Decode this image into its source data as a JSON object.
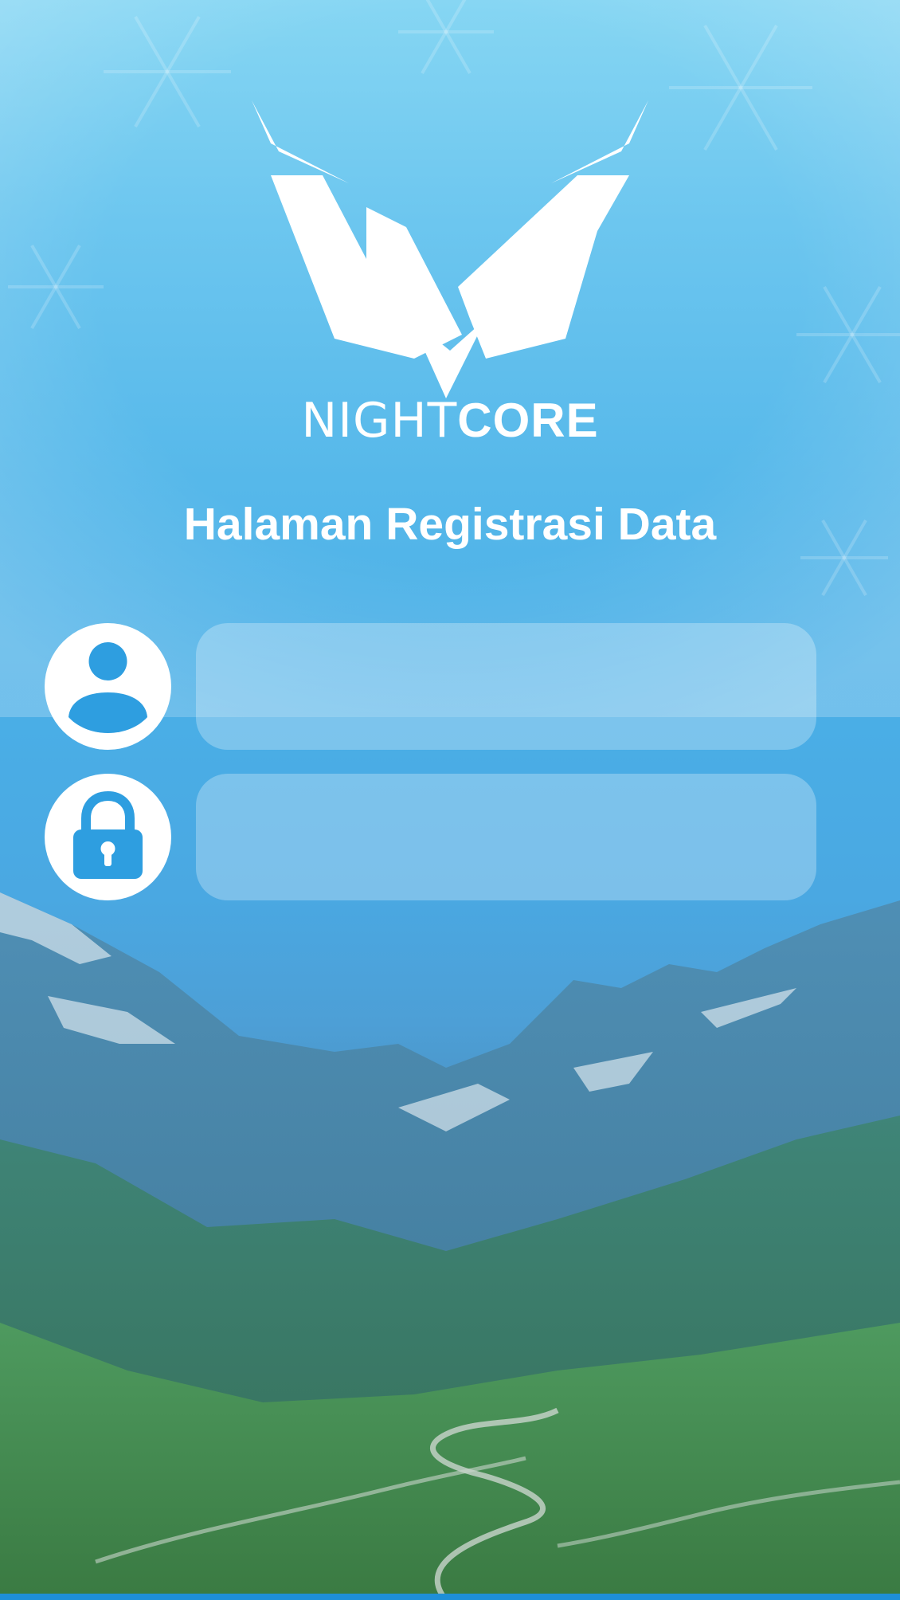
{
  "app": {
    "brand_light": "NIGHT",
    "brand_bold": "CORE"
  },
  "page": {
    "title": "Halaman Registrasi Data"
  },
  "form": {
    "username": {
      "value": "",
      "placeholder": "",
      "icon": "user-icon"
    },
    "password": {
      "value": "",
      "placeholder": "",
      "icon": "lock-icon"
    }
  },
  "colors": {
    "sky_top": "#86d6f3",
    "sky_mid": "#4aaee6",
    "accent": "#1e8fd8",
    "icon_fill": "#2e9ee0"
  }
}
